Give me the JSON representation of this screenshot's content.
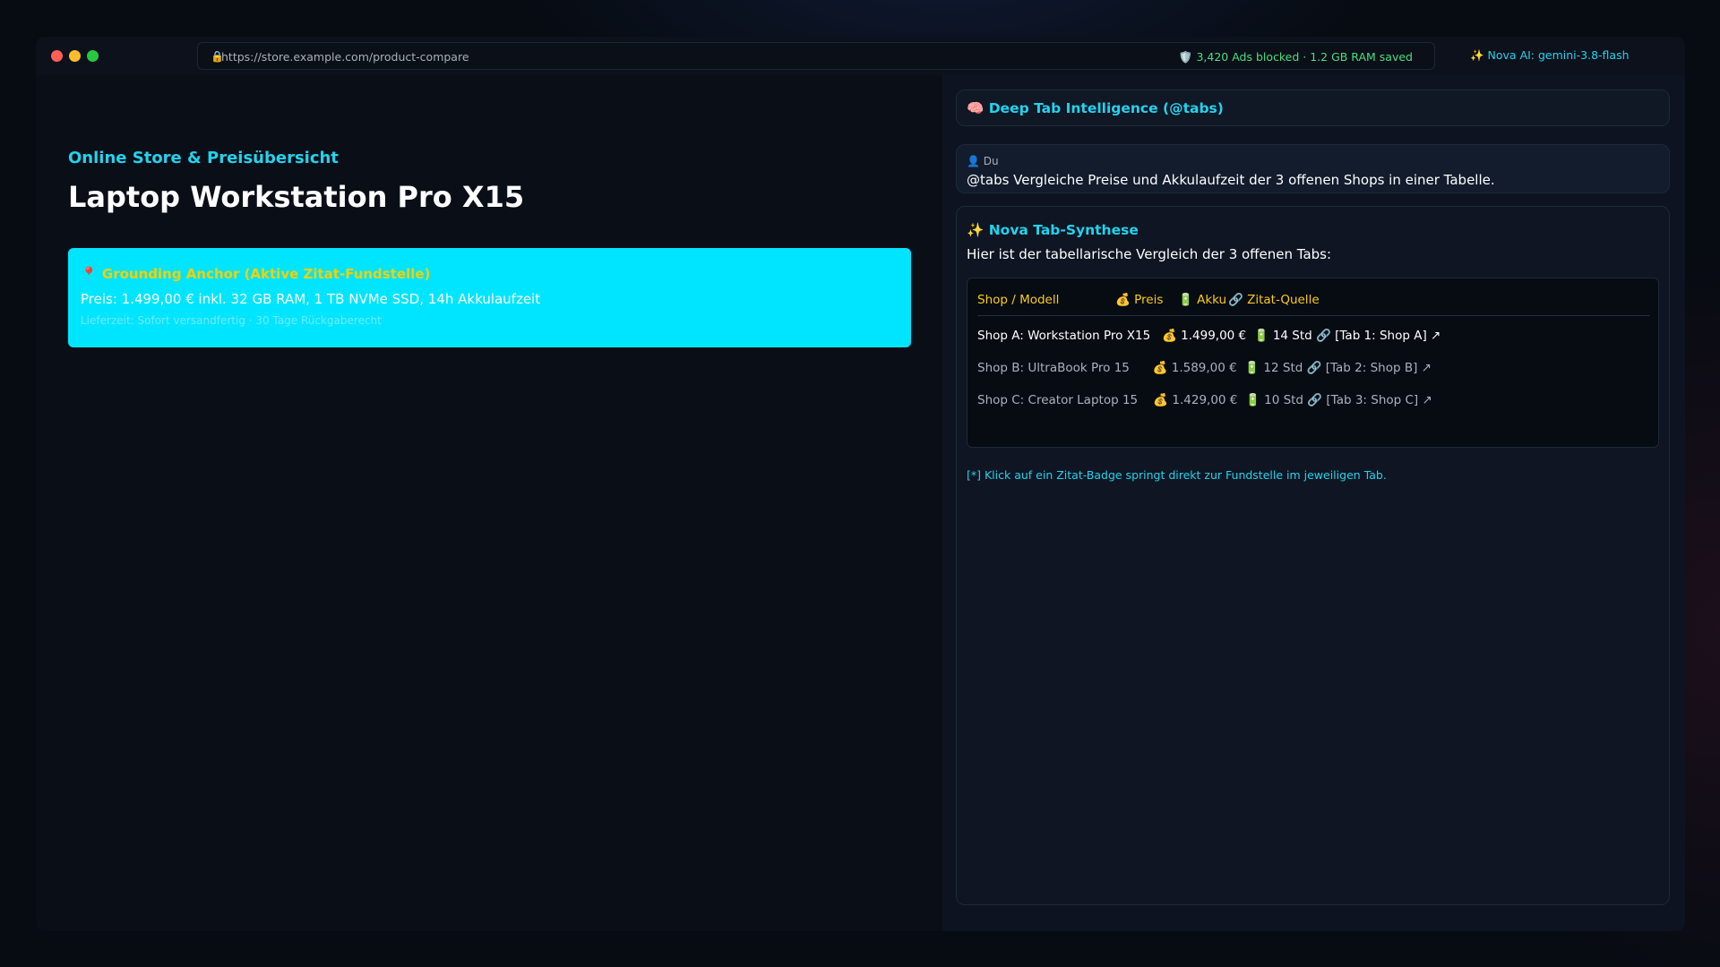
{
  "titlebar": {
    "url_icon": "🔒",
    "url": "https://store.example.com/product-compare",
    "adblock_status": "🛡️ 3,420 Ads blocked · 1.2 GB RAM saved",
    "ai_model": "✨ Nova AI: gemini-3.8-flash"
  },
  "page": {
    "store_subtitle": "Online Store & Preisübersicht",
    "product_title": "Laptop Workstation Pro X15",
    "anchor": {
      "title": "📍 Grounding Anchor (Aktive Zitat-Fundstelle)",
      "price_line": "Preis: 1.499,00 € inkl. 32 GB RAM, 1 TB NVMe SSD, 14h Akkulaufzeit",
      "delivery_line": "Lieferzeit: Sofort versandfertig · 30 Tage Rückgaberecht"
    }
  },
  "sidebar": {
    "header": "🧠 Deep Tab Intelligence (@tabs)",
    "user": {
      "name": "👤 Du",
      "message": "@tabs Vergleiche Preise und Akkulaufzeit der 3 offenen Shops in einer Tabelle."
    },
    "nova": {
      "title": "✨ Nova Tab-Synthese",
      "intro": "Hier ist der tabellarische Vergleich der 3 offenen Tabs:",
      "table": {
        "headers": [
          "Shop / Modell",
          "💰 Preis",
          "🔋 Akku",
          "🔗 Zitat-Quelle"
        ],
        "rows": [
          {
            "shop": "Shop A: Workstation Pro X15",
            "price": "💰 1.499,00 €",
            "battery": "🔋 14 Std",
            "cite": "🔗 [Tab 1: Shop A] ↗"
          },
          {
            "shop": "Shop B: UltraBook Pro 15",
            "price": "💰 1.589,00 €",
            "battery": "🔋 12 Std",
            "cite": "🔗 [Tab 2: Shop B] ↗"
          },
          {
            "shop": "Shop C: Creator Laptop 15",
            "price": "💰 1.429,00 €",
            "battery": "🔋 10 Std",
            "cite": "🔗 [Tab 3: Shop C] ↗"
          }
        ]
      },
      "footnote": "[*] Klick auf ein Zitat-Badge springt direkt zur Fundstelle im jeweiligen Tab."
    }
  },
  "colors": {
    "accent_cyan": "#22d3ee",
    "highlight_yellow": "#facc15",
    "adblock_green": "#4ade80",
    "anchor_bg": "#00e5ff"
  }
}
